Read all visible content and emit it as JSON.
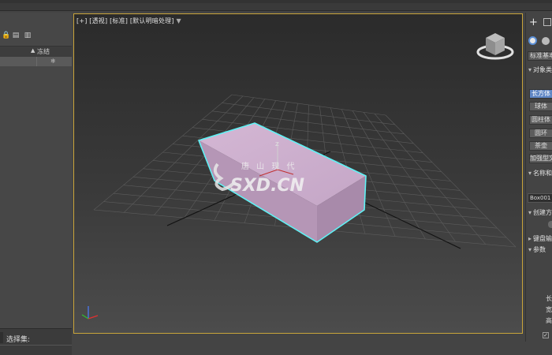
{
  "explorer": {
    "column_header": "冻结",
    "selection_set_label": "选择集:",
    "tool_icons": [
      "lock-icon",
      "hierarchy-icon",
      "layer-icon"
    ],
    "row_icon": "snowflake-icon"
  },
  "viewport": {
    "label": "[+] [透视] [标准] [默认明暗处理]",
    "menu_icon": "triangle-down-icon",
    "axis_label": "Z",
    "watermark_top": "唐 山 现 代",
    "watermark_bottom": "SXD.CN",
    "object_color": "#c8a8c8",
    "selection_color": "#5ff2f5",
    "frame_color": "#c9a43a"
  },
  "command_panel": {
    "dropdown": "标准基本体",
    "sections": {
      "object_type": "对象类型",
      "name_color": "名称和颜色",
      "creation_method": "创建方法",
      "keyboard_entry": "键盘输入",
      "parameters": "参数"
    },
    "object_buttons": [
      "长方体",
      "球体",
      "圆柱体",
      "圆环",
      "茶壶",
      "加强型文本"
    ],
    "name_value": "Box001",
    "param_labels": [
      "长",
      "宽",
      "高"
    ],
    "accent_color": "#5f86c4"
  }
}
